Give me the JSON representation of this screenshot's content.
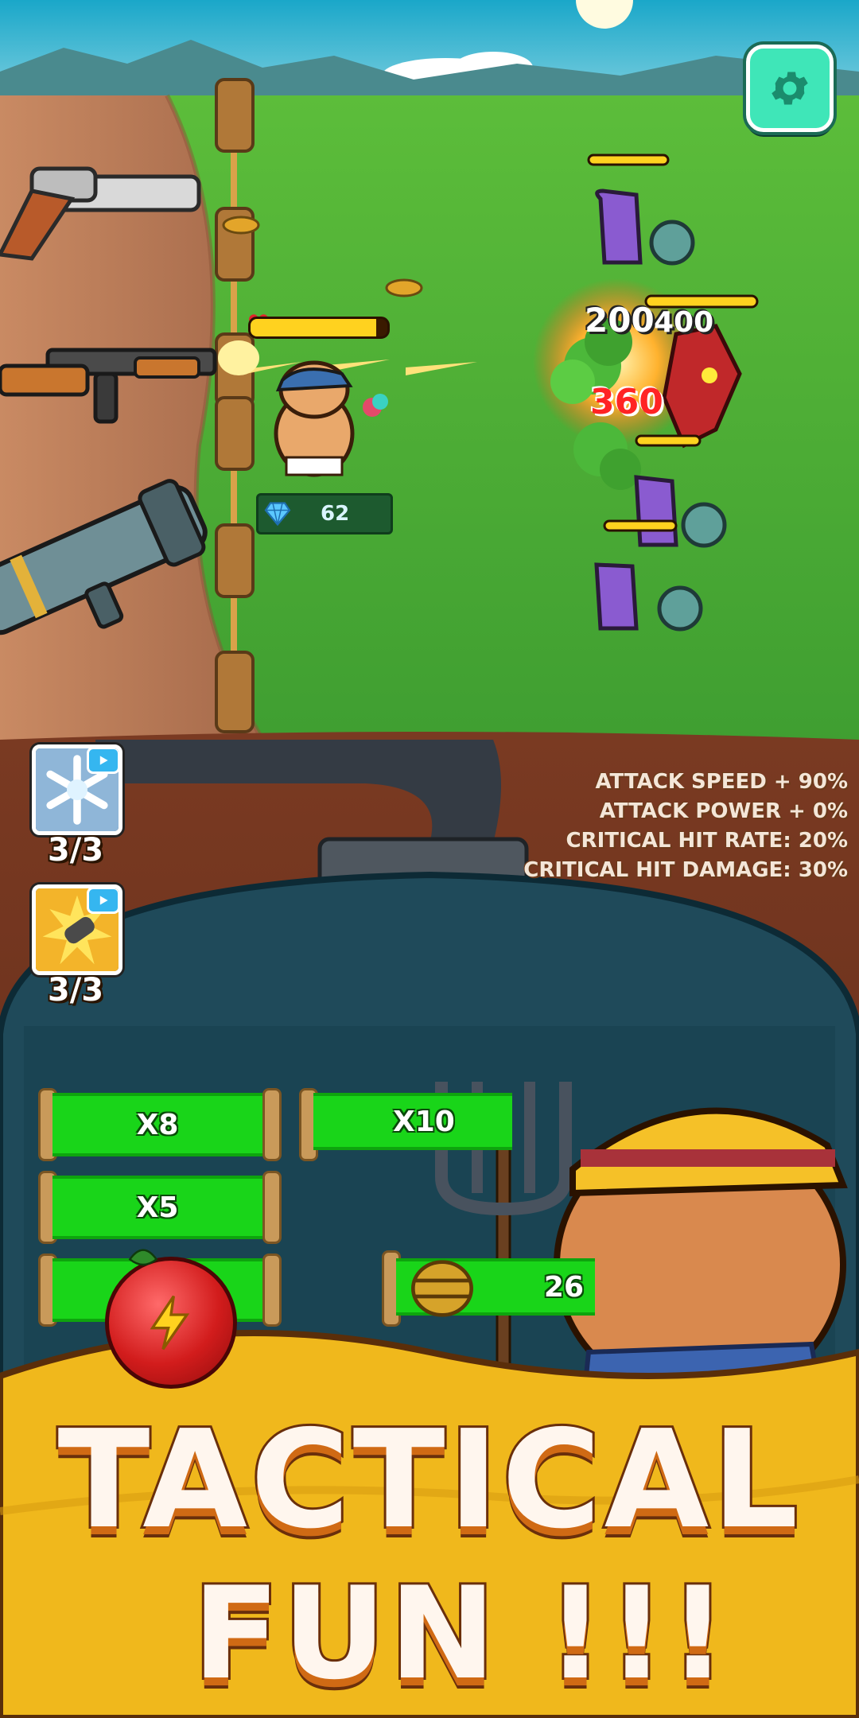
{
  "game": {
    "player": {
      "hp_fraction": 0.92,
      "gems": "62"
    },
    "damage_numbers": [
      "200",
      "400",
      "360"
    ],
    "stats": [
      "ATTACK SPEED + 90%",
      "ATTACK POWER + 0%",
      "CRITICAL HIT RATE: 20%",
      "CRITICAL HIT DAMAGE: 30%"
    ],
    "skills": [
      {
        "name": "freeze-skill",
        "count": "3/3"
      },
      {
        "name": "bullet-skill",
        "count": "3/3"
      }
    ],
    "multipliers": [
      {
        "label": "X8"
      },
      {
        "label": "X10"
      },
      {
        "label": "X5"
      },
      {
        "label": "26"
      }
    ],
    "banner": {
      "line1": "TACTICAL",
      "line2": "FUN !!!"
    },
    "icons": {
      "settings": "gear-icon",
      "gem": "diamond-icon",
      "heart": "heart-icon",
      "bolt": "lightning-icon"
    },
    "colors": {
      "accent": "#3fe6b8",
      "grass": "#4ab83a",
      "banner_yellow": "#f0b81c",
      "bar_green": "#19d519"
    }
  }
}
